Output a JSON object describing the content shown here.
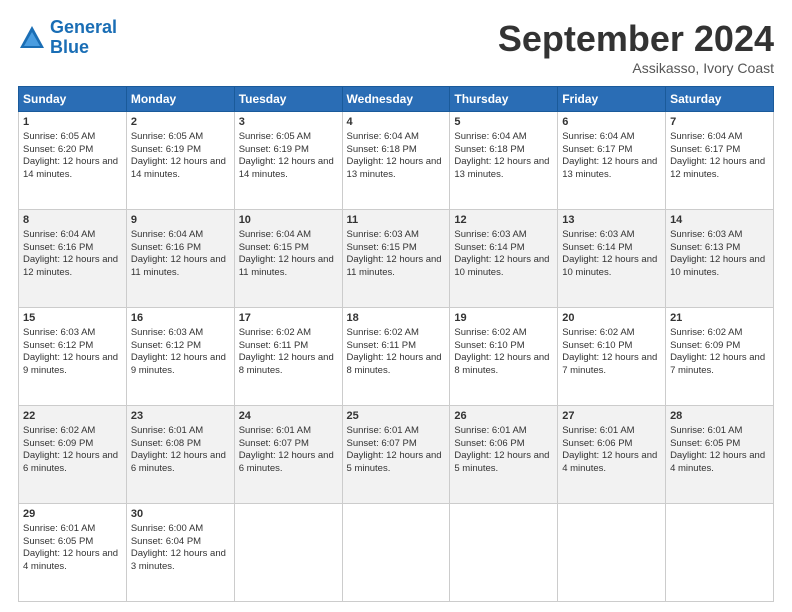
{
  "logo": {
    "line1": "General",
    "line2": "Blue"
  },
  "header": {
    "month": "September 2024",
    "location": "Assikasso, Ivory Coast"
  },
  "days_of_week": [
    "Sunday",
    "Monday",
    "Tuesday",
    "Wednesday",
    "Thursday",
    "Friday",
    "Saturday"
  ],
  "weeks": [
    [
      {
        "day": "1",
        "info": "Sunrise: 6:05 AM\nSunset: 6:20 PM\nDaylight: 12 hours and 14 minutes."
      },
      {
        "day": "2",
        "info": "Sunrise: 6:05 AM\nSunset: 6:19 PM\nDaylight: 12 hours and 14 minutes."
      },
      {
        "day": "3",
        "info": "Sunrise: 6:05 AM\nSunset: 6:19 PM\nDaylight: 12 hours and 14 minutes."
      },
      {
        "day": "4",
        "info": "Sunrise: 6:04 AM\nSunset: 6:18 PM\nDaylight: 12 hours and 13 minutes."
      },
      {
        "day": "5",
        "info": "Sunrise: 6:04 AM\nSunset: 6:18 PM\nDaylight: 12 hours and 13 minutes."
      },
      {
        "day": "6",
        "info": "Sunrise: 6:04 AM\nSunset: 6:17 PM\nDaylight: 12 hours and 13 minutes."
      },
      {
        "day": "7",
        "info": "Sunrise: 6:04 AM\nSunset: 6:17 PM\nDaylight: 12 hours and 12 minutes."
      }
    ],
    [
      {
        "day": "8",
        "info": "Sunrise: 6:04 AM\nSunset: 6:16 PM\nDaylight: 12 hours and 12 minutes."
      },
      {
        "day": "9",
        "info": "Sunrise: 6:04 AM\nSunset: 6:16 PM\nDaylight: 12 hours and 11 minutes."
      },
      {
        "day": "10",
        "info": "Sunrise: 6:04 AM\nSunset: 6:15 PM\nDaylight: 12 hours and 11 minutes."
      },
      {
        "day": "11",
        "info": "Sunrise: 6:03 AM\nSunset: 6:15 PM\nDaylight: 12 hours and 11 minutes."
      },
      {
        "day": "12",
        "info": "Sunrise: 6:03 AM\nSunset: 6:14 PM\nDaylight: 12 hours and 10 minutes."
      },
      {
        "day": "13",
        "info": "Sunrise: 6:03 AM\nSunset: 6:14 PM\nDaylight: 12 hours and 10 minutes."
      },
      {
        "day": "14",
        "info": "Sunrise: 6:03 AM\nSunset: 6:13 PM\nDaylight: 12 hours and 10 minutes."
      }
    ],
    [
      {
        "day": "15",
        "info": "Sunrise: 6:03 AM\nSunset: 6:12 PM\nDaylight: 12 hours and 9 minutes."
      },
      {
        "day": "16",
        "info": "Sunrise: 6:03 AM\nSunset: 6:12 PM\nDaylight: 12 hours and 9 minutes."
      },
      {
        "day": "17",
        "info": "Sunrise: 6:02 AM\nSunset: 6:11 PM\nDaylight: 12 hours and 8 minutes."
      },
      {
        "day": "18",
        "info": "Sunrise: 6:02 AM\nSunset: 6:11 PM\nDaylight: 12 hours and 8 minutes."
      },
      {
        "day": "19",
        "info": "Sunrise: 6:02 AM\nSunset: 6:10 PM\nDaylight: 12 hours and 8 minutes."
      },
      {
        "day": "20",
        "info": "Sunrise: 6:02 AM\nSunset: 6:10 PM\nDaylight: 12 hours and 7 minutes."
      },
      {
        "day": "21",
        "info": "Sunrise: 6:02 AM\nSunset: 6:09 PM\nDaylight: 12 hours and 7 minutes."
      }
    ],
    [
      {
        "day": "22",
        "info": "Sunrise: 6:02 AM\nSunset: 6:09 PM\nDaylight: 12 hours and 6 minutes."
      },
      {
        "day": "23",
        "info": "Sunrise: 6:01 AM\nSunset: 6:08 PM\nDaylight: 12 hours and 6 minutes."
      },
      {
        "day": "24",
        "info": "Sunrise: 6:01 AM\nSunset: 6:07 PM\nDaylight: 12 hours and 6 minutes."
      },
      {
        "day": "25",
        "info": "Sunrise: 6:01 AM\nSunset: 6:07 PM\nDaylight: 12 hours and 5 minutes."
      },
      {
        "day": "26",
        "info": "Sunrise: 6:01 AM\nSunset: 6:06 PM\nDaylight: 12 hours and 5 minutes."
      },
      {
        "day": "27",
        "info": "Sunrise: 6:01 AM\nSunset: 6:06 PM\nDaylight: 12 hours and 4 minutes."
      },
      {
        "day": "28",
        "info": "Sunrise: 6:01 AM\nSunset: 6:05 PM\nDaylight: 12 hours and 4 minutes."
      }
    ],
    [
      {
        "day": "29",
        "info": "Sunrise: 6:01 AM\nSunset: 6:05 PM\nDaylight: 12 hours and 4 minutes."
      },
      {
        "day": "30",
        "info": "Sunrise: 6:00 AM\nSunset: 6:04 PM\nDaylight: 12 hours and 3 minutes."
      },
      {
        "day": "",
        "info": ""
      },
      {
        "day": "",
        "info": ""
      },
      {
        "day": "",
        "info": ""
      },
      {
        "day": "",
        "info": ""
      },
      {
        "day": "",
        "info": ""
      }
    ]
  ]
}
